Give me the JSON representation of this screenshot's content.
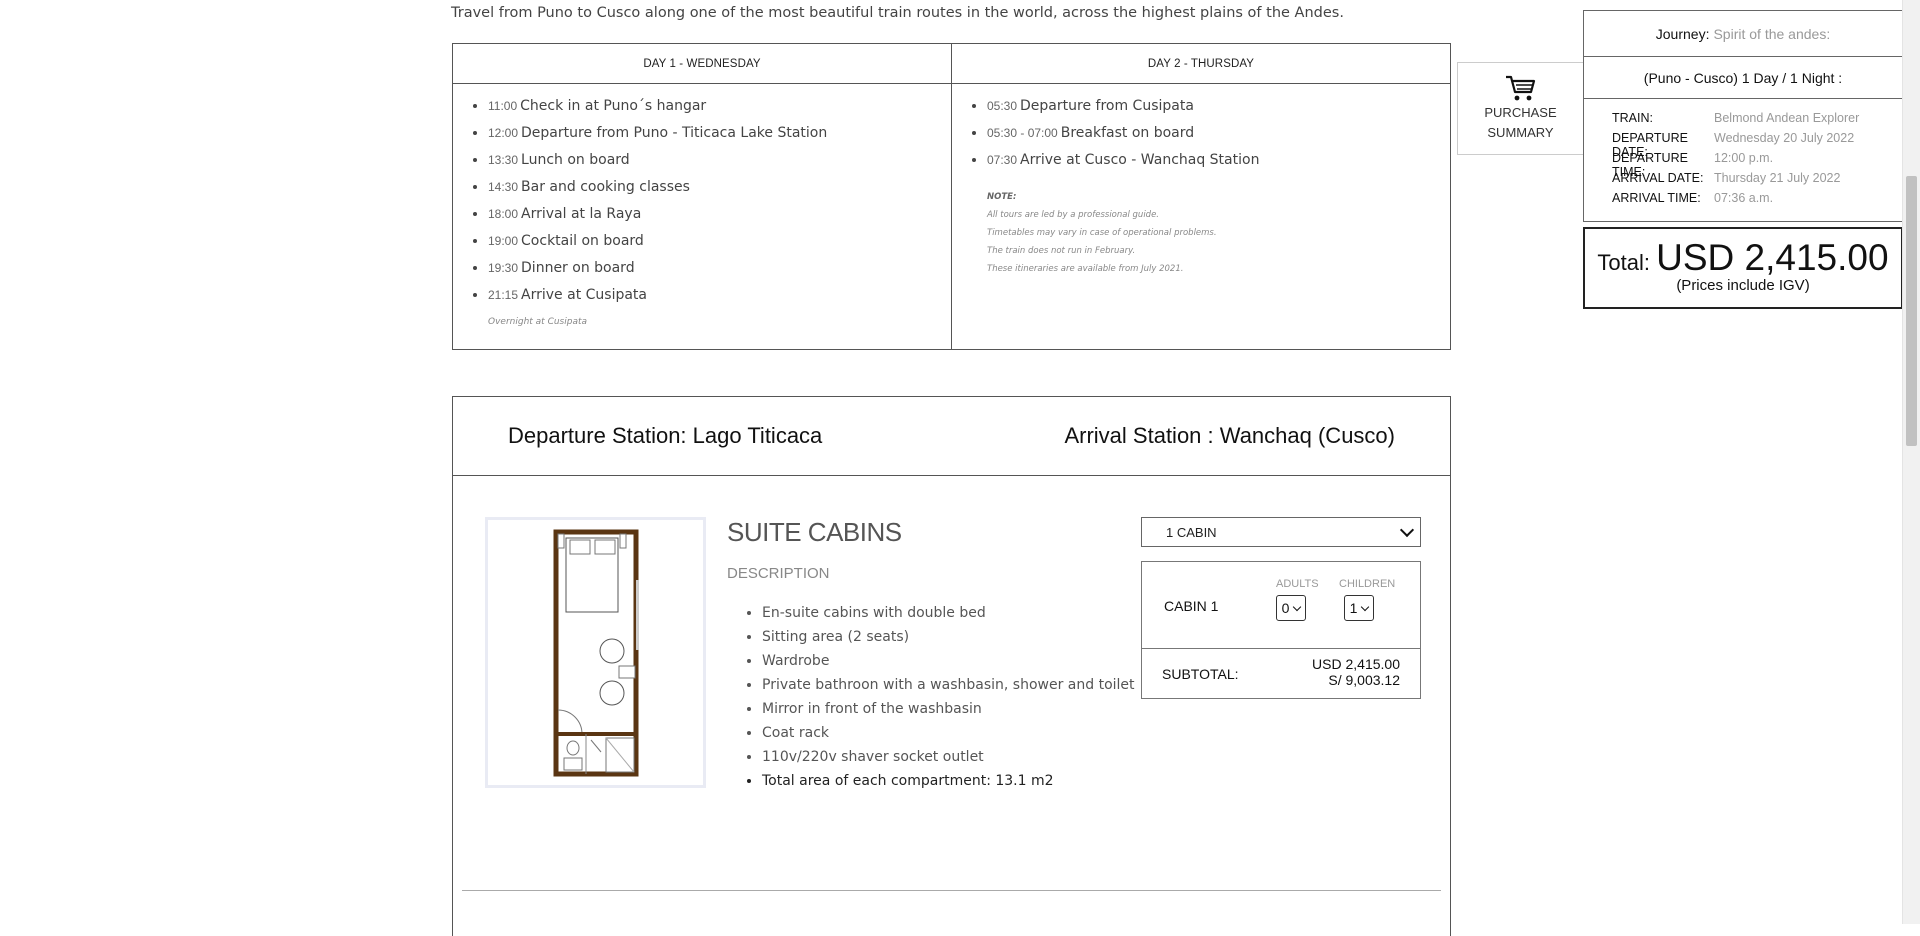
{
  "intro": "Travel from Puno to Cusco along one of the most beautiful train routes in the world, across the highest plains of the Andes.",
  "itinerary": {
    "day1": {
      "title": "DAY 1 - WEDNESDAY",
      "items": [
        {
          "time": "11:00",
          "text": "Check in at Puno´s hangar"
        },
        {
          "time": "12:00",
          "text": "Departure from Puno - Titicaca Lake Station"
        },
        {
          "time": "13:30",
          "text": "Lunch on board"
        },
        {
          "time": "14:30",
          "text": "Bar and cooking classes"
        },
        {
          "time": "18:00",
          "text": "Arrival at la Raya"
        },
        {
          "time": "19:00",
          "text": "Cocktail on board"
        },
        {
          "time": "19:30",
          "text": "Dinner on board"
        },
        {
          "time": "21:15",
          "text": "Arrive at Cusipata"
        }
      ],
      "footnote": "Overnight at Cusipata"
    },
    "day2": {
      "title": "DAY 2 - THURSDAY",
      "items": [
        {
          "time": "05:30",
          "text": "Departure from Cusipata"
        },
        {
          "time": "05:30 - 07:00",
          "text": "Breakfast on board"
        },
        {
          "time": "07:30",
          "text": "Arrive at Cusco - Wanchaq Station"
        }
      ],
      "note": {
        "heading": "NOTE:",
        "lines": [
          "All tours are led by a professional guide.",
          "Timetables may vary in case of operational problems.",
          "The train does not run in February.",
          "These itineraries are available from July 2021."
        ]
      }
    }
  },
  "purchase_button": {
    "line1": "PURCHASE",
    "line2": "SUMMARY",
    "icon": "cart-icon"
  },
  "summary": {
    "journey_label": "Journey:",
    "journey_value": "Spirit of the andes:",
    "route": "(Puno - Cusco) 1 Day / 1 Night :",
    "details": [
      {
        "label": "TRAIN:",
        "value": "Belmond Andean Explorer"
      },
      {
        "label": "DEPARTURE DATE:",
        "value": "Wednesday 20 July 2022"
      },
      {
        "label": "DEPARTURE TIME:",
        "value": "12:00 p.m."
      },
      {
        "label": "ARRIVAL DATE:",
        "value": "Thursday 21 July 2022"
      },
      {
        "label": "ARRIVAL TIME:",
        "value": "07:36 a.m."
      }
    ],
    "total_label": "Total:",
    "total_amount": "USD 2,415.00",
    "total_note": "(Prices include IGV)"
  },
  "stations": {
    "departure": "Departure Station: Lago Titicaca",
    "arrival": "Arrival Station : Wanchaq (Cusco)"
  },
  "cabin": {
    "title": "SUITE CABINS",
    "description_heading": "DESCRIPTION",
    "features": [
      "En-suite cabins with double bed",
      "Sitting area (2 seats)",
      "Wardrobe",
      "Private bathroon with a washbasin, shower and toilet",
      "Mirror in front of the washbasin",
      "Coat rack",
      "110v/220v shaver socket outlet",
      "Total area of each compartment: 13.1 m2"
    ],
    "cabins_select": "1 CABIN",
    "cabin_label": "CABIN 1",
    "adults_label": "ADULTS",
    "adults_value": "0",
    "children_label": "CHILDREN",
    "children_value": "1",
    "subtotal_label": "SUBTOTAL:",
    "subtotal_usd": "USD 2,415.00",
    "subtotal_pen": "S/ 9,003.12"
  },
  "colors": {
    "border": "#555555",
    "muted": "#999999",
    "floorplan_wall": "#5a3512"
  }
}
